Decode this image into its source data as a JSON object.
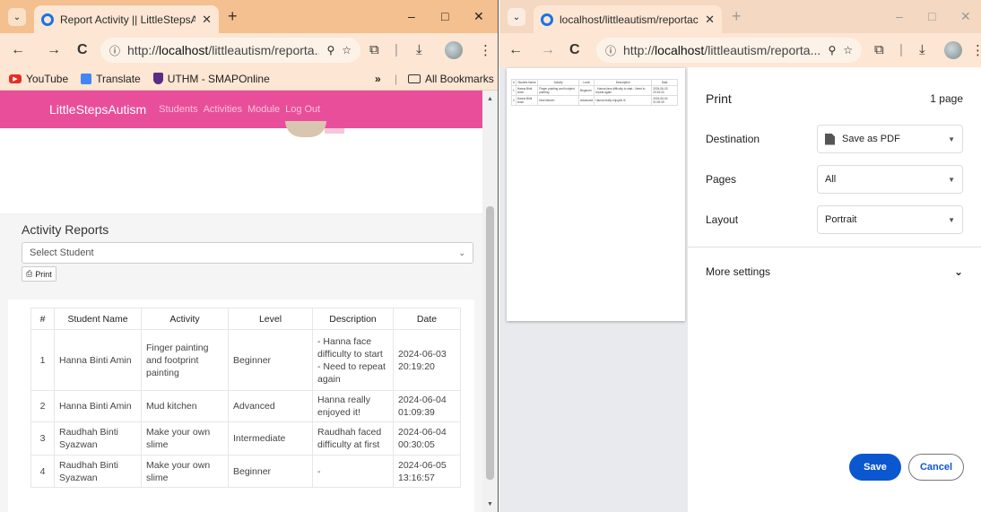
{
  "left": {
    "tab": {
      "title": "Report Activity || LittleStepsAutism",
      "close": "✕"
    },
    "window_controls": {
      "minimize": "–",
      "maximize": "□",
      "close": "✕"
    },
    "newtab": "+",
    "toolbar": {
      "back": "←",
      "forward": "→",
      "reload": "C",
      "url_prefix": "http://",
      "url_host": "localhost",
      "url_rest": "/littleautism/reporta...",
      "zoom_icon": "⚲",
      "star_icon": "☆",
      "ext_icon": "⧉",
      "download_icon": "⤓",
      "menu_icon": "⋮"
    },
    "bookmarks": {
      "items": [
        "YouTube",
        "Translate",
        "UTHM - SMAPOnline"
      ],
      "overflow": "»",
      "all": "All Bookmarks"
    },
    "navbar": {
      "brand": "LittleStepsAutism",
      "links": [
        "Students",
        "Activities",
        "Module",
        "Log Out"
      ]
    },
    "report": {
      "title": "Activity Reports",
      "select_placeholder": "Select Student",
      "print_label": "Print",
      "columns": [
        "#",
        "Student Name",
        "Activity",
        "Level",
        "Description",
        "Date"
      ],
      "rows": [
        {
          "num": "1",
          "name": "Hanna Binti Amin",
          "activity": "Finger painting and footprint painting",
          "level": "Beginner",
          "description": "- Hanna face difficulty to start - Need to repeat again",
          "date": "2024-06-03 20:19:20"
        },
        {
          "num": "2",
          "name": "Hanna Binti Amin",
          "activity": "Mud kitchen",
          "level": "Advanced",
          "description": "Hanna really enjoyed it!",
          "date": "2024-06-04 01:09:39"
        },
        {
          "num": "3",
          "name": "Raudhah Binti Syazwan",
          "activity": "Make your own slime",
          "level": "Intermediate",
          "description": "Raudhah faced difficulty at first",
          "date": "2024-06-04 00:30:05"
        },
        {
          "num": "4",
          "name": "Raudhah Binti Syazwan",
          "activity": "Make your own slime",
          "level": "Beginner",
          "description": "-",
          "date": "2024-06-05 13:16:57"
        }
      ]
    }
  },
  "right": {
    "tab": {
      "title": "localhost/littleautism/reportact",
      "close": "✕"
    },
    "window_controls": {
      "minimize": "–",
      "maximize": "□",
      "close": "✕"
    },
    "newtab": "+",
    "toolbar": {
      "back": "←",
      "forward": "→",
      "reload": "C",
      "url_prefix": "http://",
      "url_host": "localhost",
      "url_rest": "/littleautism/reporta..."
    },
    "print": {
      "title": "Print",
      "page_count": "1 page",
      "destination_label": "Destination",
      "destination_value": "Save as PDF",
      "pages_label": "Pages",
      "pages_value": "All",
      "layout_label": "Layout",
      "layout_value": "Portrait",
      "more_settings": "More settings",
      "save": "Save",
      "cancel": "Cancel"
    }
  },
  "colors": {
    "navbar": "#e94e9b",
    "save_button": "#0b57d0",
    "tab_strip_left": "#f4c08f"
  }
}
